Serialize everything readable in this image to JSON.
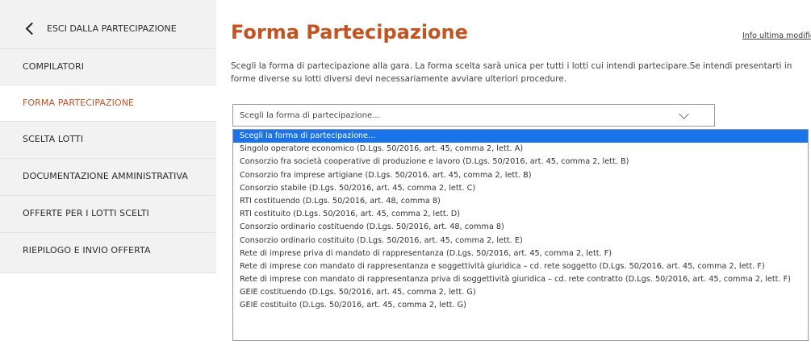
{
  "sidebar": {
    "back_label": "ESCI DALLA PARTECIPAZIONE",
    "items": [
      {
        "label": "COMPILATORI"
      },
      {
        "label": "FORMA PARTECIPAZIONE"
      },
      {
        "label": "SCELTA LOTTI"
      },
      {
        "label": "DOCUMENTAZIONE AMMINISTRATIVA"
      },
      {
        "label": "OFFERTE PER I LOTTI SCELTI"
      },
      {
        "label": "RIEPILOGO E INVIO OFFERTA"
      }
    ],
    "active_color": "#c4531f"
  },
  "main": {
    "title": "Forma Partecipazione",
    "info_link": "Info ultima modifica",
    "description": "Scegli la forma di partecipazione alla gara. La forma scelta sarà unica per tutti i lotti cui intendi partecipare.Se intendi presentarti in forme diverse su lotti diversi devi necessariamente avviare ulteriori procedure.",
    "select": {
      "value": "Scegli la forma di partecipazione...",
      "options": [
        "Scegli la forma di partecipazione...",
        "Singolo operatore economico (D.Lgs. 50/2016, art. 45, comma 2, lett. A)",
        "Consorzio fra società cooperative di produzione e lavoro (D.Lgs. 50/2016, art. 45, comma 2, lett. B)",
        "Consorzio fra imprese artigiane (D.Lgs. 50/2016, art. 45, comma 2, lett. B)",
        "Consorzio stabile (D.Lgs. 50/2016, art. 45, comma 2, lett. C)",
        "RTI costituendo (D.Lgs. 50/2016, art. 48, comma 8)",
        "RTI costituito (D.Lgs. 50/2016, art. 45, comma 2, lett. D)",
        "Consorzio ordinario costituendo (D.Lgs. 50/2016, art. 48, comma 8)",
        "Consorzio ordinario costituito (D.Lgs. 50/2016, art. 45, comma 2, lett. E)",
        "Rete di imprese priva di mandato di rappresentanza (D.Lgs. 50/2016, art. 45, comma 2, lett. F)",
        "Rete di imprese con mandato di rappresentanza e soggettività giuridica – cd. rete soggetto (D.Lgs. 50/2016, art. 45, comma 2, lett. F)",
        "Rete di imprese con mandato di rappresentanza priva di soggettività giuridica – cd. rete contratto (D.Lgs. 50/2016, art. 45, comma 2, lett. F)",
        "GEIE costituendo (D.Lgs. 50/2016, art. 45, comma 2, lett. G)",
        "GEIE costituito (D.Lgs. 50/2016, art. 45, comma 2, lett. G)"
      ],
      "highlight_color": "#1a73e8"
    }
  }
}
